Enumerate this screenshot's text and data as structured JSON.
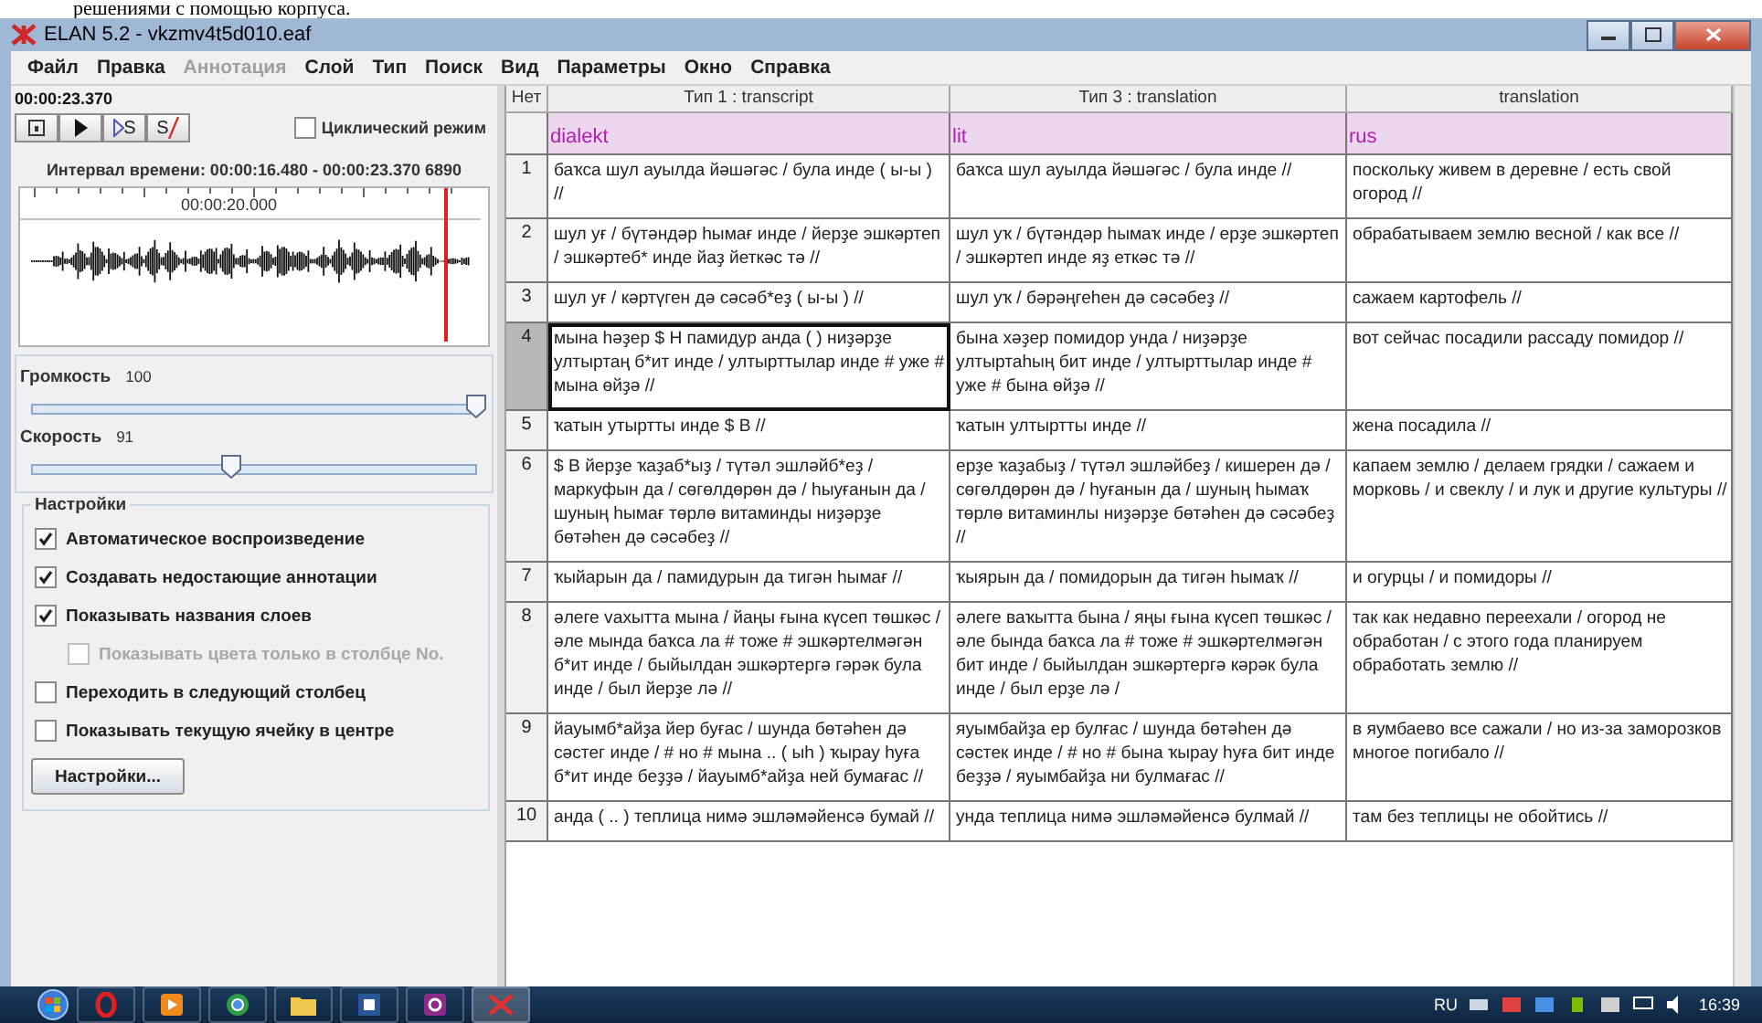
{
  "document_strip": {
    "text": "решениями с помощью корпуса."
  },
  "window": {
    "title": "ELAN 5.2 - vkzmv4t5d010.eaf"
  },
  "menu": [
    {
      "label": "Файл",
      "disabled": false
    },
    {
      "label": "Правка",
      "disabled": false
    },
    {
      "label": "Аннотация",
      "disabled": true
    },
    {
      "label": "Слой",
      "disabled": false
    },
    {
      "label": "Тип",
      "disabled": false
    },
    {
      "label": "Поиск",
      "disabled": false
    },
    {
      "label": "Вид",
      "disabled": false
    },
    {
      "label": "Параметры",
      "disabled": false
    },
    {
      "label": "Окно",
      "disabled": false
    },
    {
      "label": "Справка",
      "disabled": false
    }
  ],
  "player": {
    "time": "00:00:23.370",
    "buttons": [
      {
        "kind": "select"
      },
      {
        "kind": "play"
      },
      {
        "kind": "play_selection",
        "label": "S"
      },
      {
        "kind": "clear_selection",
        "label": "S"
      }
    ],
    "loop": {
      "label": "Циклический режим",
      "checked": false
    },
    "interval": "Интервал времени: 00:00:16.480 - 00:00:23.370  6890",
    "ruler_label": "00:00:20.000"
  },
  "sliders": [
    {
      "label": "Громкость",
      "reading": "100",
      "level": 1.0
    },
    {
      "label": "Скорость",
      "reading": "91",
      "level": 0.45
    }
  ],
  "settings": {
    "title": "Настройки",
    "options": [
      {
        "label": "Автоматическое воспроизведение",
        "checked": true,
        "disabled": false
      },
      {
        "label": "Создавать недостающие аннотации",
        "checked": true,
        "disabled": false
      },
      {
        "label": "Показывать названия слоев",
        "checked": true,
        "disabled": false,
        "children": [
          {
            "label": "Показывать цвета только в столбце No.",
            "checked": false,
            "disabled": true
          }
        ]
      },
      {
        "label": "Переходить в следующий столбец",
        "checked": false,
        "disabled": false
      },
      {
        "label": "Показывать текущую ячейку в центре",
        "checked": false,
        "disabled": false
      }
    ],
    "button": "Настройки..."
  },
  "table": {
    "columns": [
      "Нет",
      "Тип 1 : transcript",
      "Тип 3 : translation",
      "translation"
    ],
    "layers": [
      "dialekt",
      "lit",
      "rus"
    ],
    "rows": [
      {
        "selected": false,
        "cells": [
          "1",
          "баҡса шул ауылда йәшәгәс / була инде ( ы-ы ) //",
          "баҡса шул ауылда йәшәгәс / була инде //",
          "поскольку живем в деревне / есть свой огород //"
        ]
      },
      {
        "selected": false,
        "cells": [
          "2",
          "шул уғ / бүтәндәр һымағ инде / йерҙе эшкәртеп / эшкәртеб* инде йаҙ йеткәс тә //",
          "шул уҡ / бүтәндәр һымаҡ инде / ерҙе эшкәртеп / эшкәртеп инде яҙ еткәс тә //",
          "обрабатываем землю весной / как все //"
        ]
      },
      {
        "selected": false,
        "cells": [
          "3",
          "шул уғ / кәртүген дә сәсәб*еҙ ( ы-ы ) //",
          "шул уҡ / бәрәңгеһен дә сәсәбеҙ //",
          "сажаем картофель //"
        ]
      },
      {
        "selected": true,
        "cells": [
          "4",
          "мына һәҙер $ Н памидур анда ( ) ниҙәрҙе ултыртаң б*ит инде / ултырттылар инде # уже # мына өйҙә //",
          "бына хәҙер помидор унда / ниҙәрҙе ултыртаһың бит инде / ултырттылар инде # уже # бына өйҙә //",
          "вот сейчас посадили рассаду помидор //"
        ]
      },
      {
        "selected": false,
        "cells": [
          "5",
          "ҡатын утыртты инде  $ В //",
          "ҡатын ултыртты инде //",
          "жена посадила //"
        ]
      },
      {
        "selected": false,
        "cells": [
          "6",
          " $ В йерҙе ҡаҙаб*ыҙ / түтәл эшләйб*еҙ / маркуфын да / сөгөлдөрөн дә / һыуғанын да / шуның һымағ төрлө витаминды ниҙәрҙе бөтәһен дә сәсәбеҙ //",
          "ерҙе ҡаҙабыҙ / түтәл эшләйбеҙ / кишерен дә / сөгөлдөрөн дә / һуғанын да / шуның һымаҡ төрлө витаминлы ниҙәрҙе бөтәһен дә сәсәбеҙ //",
          "капаем землю / делаем грядки / сажаем и морковь / и свеклу / и лук и другие культуры //"
        ]
      },
      {
        "selected": false,
        "cells": [
          "7",
          "ҡыйарын да / памидурын да тигән һымағ //",
          "ҡыярын да / помидорын да тигән һымаҡ //",
          "и огурцы / и помидоры //"
        ]
      },
      {
        "selected": false,
        "cells": [
          "8",
          "әлеге vахытта мына / йаңы ғына күсеп төшкәс / әле мында баҡса ла # тоже # эшкәртелмәгән б*ит инде / быйылдан эшкәртергә гәрәк була инде / был йерҙе лә //",
          "әлеге ваҡытта бына / яңы ғына күсеп төшкәс / әле бында баҡса ла # тоже # эшкәртелмәгән бит инде / быйылдан эшкәртергә кәрәк була инде / был ерҙе лә /",
          "так как недавно переехали / огород не обработан / с этого года планируем обработать землю //"
        ]
      },
      {
        "selected": false,
        "cells": [
          "9",
          "йауымб*айҙа йер буғас / шунда бөтәһен дә сәстег инде / # но # мына ..  ( ыһ ) ҡырау һуға б*ит инде беҙҙә / йауымб*айҙа ней бумағас //",
          "яуымбайҙа ер булғас / шунда бөтәһен дә сәстек инде / # но # бына ҡырау һуға бит инде беҙҙә / яуымбайҙа ни булмағас //",
          "в яумбаево все сажали / но из-за заморозков многое погибало //"
        ]
      },
      {
        "selected": false,
        "cells": [
          "10",
          "анда ( .. ) теплица нимә  эшләмәйенсә бумай //",
          "унда теплица нимә  эшләмәйенсә булмай //",
          "там без теплицы не обойтись //"
        ]
      }
    ]
  },
  "taskbar": {
    "language": "RU",
    "clock": "16:39"
  }
}
